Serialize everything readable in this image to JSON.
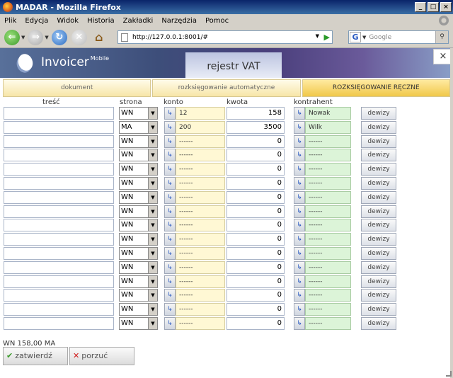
{
  "window": {
    "title": "MADAR - Mozilla Firefox"
  },
  "menu": [
    "Plik",
    "Edycja",
    "Widok",
    "Historia",
    "Zakładki",
    "Narzędzia",
    "Pomoc"
  ],
  "nav": {
    "url": "http://127.0.0.1:8001/#",
    "search_placeholder": "Google"
  },
  "app": {
    "logo": "Invoicer",
    "logo_sup": "Mobile",
    "page_tab": "rejestr VAT",
    "close": "×",
    "tabs": [
      "dokument",
      "rozksięgowanie automatyczne",
      "ROZKSIĘGOWANIE RĘCZNE"
    ],
    "headers": {
      "tresc": "treść",
      "strona": "strona",
      "konto": "konto",
      "kwota": "kwota",
      "kontrahent": "kontrahent"
    },
    "rows": [
      {
        "strona": "WN",
        "konto": "12",
        "kwota": "158",
        "kontrahent": "Nowak"
      },
      {
        "strona": "MA",
        "konto": "200",
        "kwota": "3500",
        "kontrahent": "Wilk"
      },
      {
        "strona": "WN",
        "konto": "------",
        "kwota": "0",
        "kontrahent": "------"
      },
      {
        "strona": "WN",
        "konto": "------",
        "kwota": "0",
        "kontrahent": "------"
      },
      {
        "strona": "WN",
        "konto": "------",
        "kwota": "0",
        "kontrahent": "------"
      },
      {
        "strona": "WN",
        "konto": "------",
        "kwota": "0",
        "kontrahent": "------"
      },
      {
        "strona": "WN",
        "konto": "------",
        "kwota": "0",
        "kontrahent": "------"
      },
      {
        "strona": "WN",
        "konto": "------",
        "kwota": "0",
        "kontrahent": "------"
      },
      {
        "strona": "WN",
        "konto": "------",
        "kwota": "0",
        "kontrahent": "------"
      },
      {
        "strona": "WN",
        "konto": "------",
        "kwota": "0",
        "kontrahent": "------"
      },
      {
        "strona": "WN",
        "konto": "------",
        "kwota": "0",
        "kontrahent": "------"
      },
      {
        "strona": "WN",
        "konto": "------",
        "kwota": "0",
        "kontrahent": "------"
      },
      {
        "strona": "WN",
        "konto": "------",
        "kwota": "0",
        "kontrahent": "------"
      },
      {
        "strona": "WN",
        "konto": "------",
        "kwota": "0",
        "kontrahent": "------"
      },
      {
        "strona": "WN",
        "konto": "------",
        "kwota": "0",
        "kontrahent": "------"
      },
      {
        "strona": "WN",
        "konto": "------",
        "kwota": "0",
        "kontrahent": "------"
      }
    ],
    "dewizy_label": "dewizy",
    "summary": "WN 158,00 MA",
    "confirm_label": "zatwierdź",
    "cancel_label": "porzuć"
  }
}
